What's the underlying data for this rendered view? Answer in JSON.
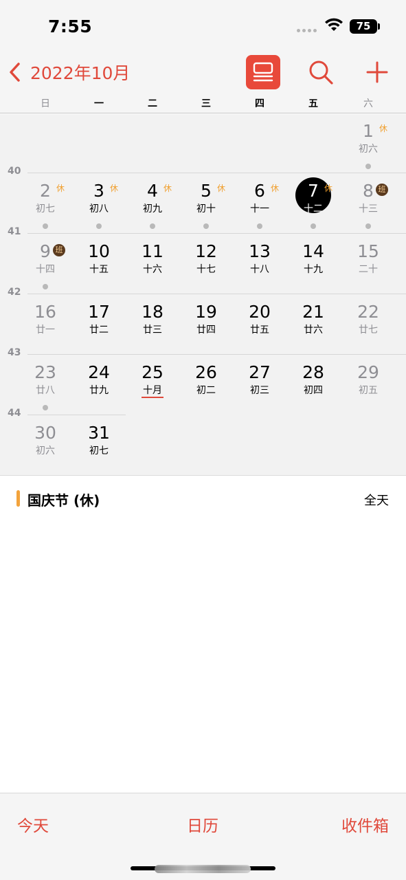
{
  "status_bar": {
    "time": "7:55",
    "battery": "75"
  },
  "nav": {
    "title": "2022年10月"
  },
  "weekdays": [
    "日",
    "一",
    "二",
    "三",
    "四",
    "五",
    "六"
  ],
  "week_numbers": [
    "40",
    "41",
    "42",
    "43",
    "44"
  ],
  "days": [
    {
      "day": "1",
      "lunar": "初六",
      "badge": "休",
      "dot": true
    },
    {
      "day": "2",
      "lunar": "初七",
      "badge": "休",
      "dot": true
    },
    {
      "day": "3",
      "lunar": "初八",
      "badge": "休",
      "dot": true
    },
    {
      "day": "4",
      "lunar": "初九",
      "badge": "休",
      "dot": true
    },
    {
      "day": "5",
      "lunar": "初十",
      "badge": "休",
      "dot": true
    },
    {
      "day": "6",
      "lunar": "十一",
      "badge": "休",
      "dot": true
    },
    {
      "day": "7",
      "lunar": "十二",
      "badge": "休",
      "dot": true,
      "selected": true
    },
    {
      "day": "8",
      "lunar": "十三",
      "badge": "班",
      "dot": true
    },
    {
      "day": "9",
      "lunar": "十四",
      "badge": "班",
      "dot": true
    },
    {
      "day": "10",
      "lunar": "十五"
    },
    {
      "day": "11",
      "lunar": "十六"
    },
    {
      "day": "12",
      "lunar": "十七"
    },
    {
      "day": "13",
      "lunar": "十八"
    },
    {
      "day": "14",
      "lunar": "十九"
    },
    {
      "day": "15",
      "lunar": "二十"
    },
    {
      "day": "16",
      "lunar": "廿一"
    },
    {
      "day": "17",
      "lunar": "廿二"
    },
    {
      "day": "18",
      "lunar": "廿三"
    },
    {
      "day": "19",
      "lunar": "廿四"
    },
    {
      "day": "20",
      "lunar": "廿五"
    },
    {
      "day": "21",
      "lunar": "廿六"
    },
    {
      "day": "22",
      "lunar": "廿七"
    },
    {
      "day": "23",
      "lunar": "廿八",
      "dot": true
    },
    {
      "day": "24",
      "lunar": "廿九"
    },
    {
      "day": "25",
      "lunar": "十月",
      "today": true
    },
    {
      "day": "26",
      "lunar": "初二"
    },
    {
      "day": "27",
      "lunar": "初三"
    },
    {
      "day": "28",
      "lunar": "初四"
    },
    {
      "day": "29",
      "lunar": "初五"
    },
    {
      "day": "30",
      "lunar": "初六"
    },
    {
      "day": "31",
      "lunar": "初七"
    }
  ],
  "event": {
    "title": "国庆节 (休)",
    "time": "全天",
    "color": "#f3a33c"
  },
  "tabs": {
    "today": "今天",
    "calendars": "日历",
    "inbox": "收件箱"
  },
  "colors": {
    "accent": "#e0493b"
  }
}
